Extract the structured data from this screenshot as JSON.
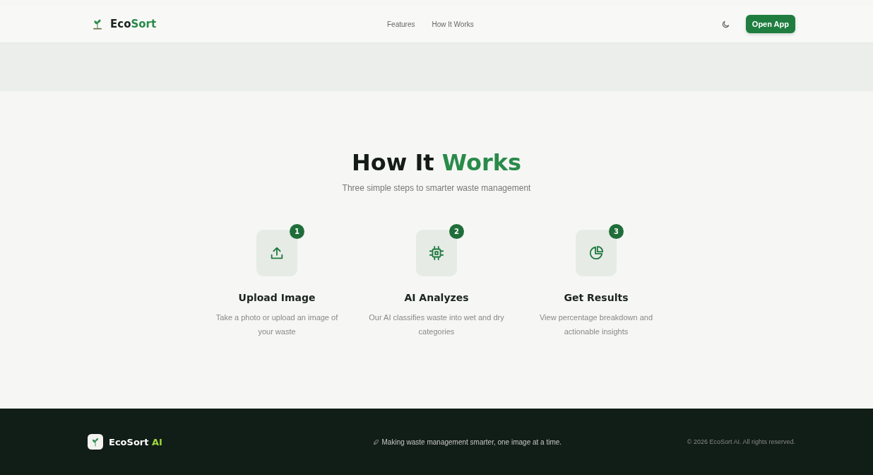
{
  "header": {
    "brand": {
      "first": "Eco",
      "second": "Sort"
    },
    "nav": [
      {
        "label": "Features"
      },
      {
        "label": "How It Works"
      }
    ],
    "theme_toggle": {
      "dark": false
    },
    "cta": "Open App"
  },
  "section": {
    "title_first": "How It",
    "title_second": "Works",
    "subtitle": "Three simple steps to smarter waste management",
    "steps": [
      {
        "number": "1",
        "title": "Upload Image",
        "text": "Take a photo or upload an image of your waste"
      },
      {
        "number": "2",
        "title": "AI Analyzes",
        "text": "Our AI classifies waste into wet and dry categories"
      },
      {
        "number": "3",
        "title": "Get Results",
        "text": "View percentage breakdown and actionable insights"
      }
    ]
  },
  "footer": {
    "brand_first": "EcoSort",
    "brand_second": "AI",
    "tagline": "Making waste management smarter, one image at a time.",
    "copyright": "© 2026 EcoSort AI. All rights reserved."
  }
}
